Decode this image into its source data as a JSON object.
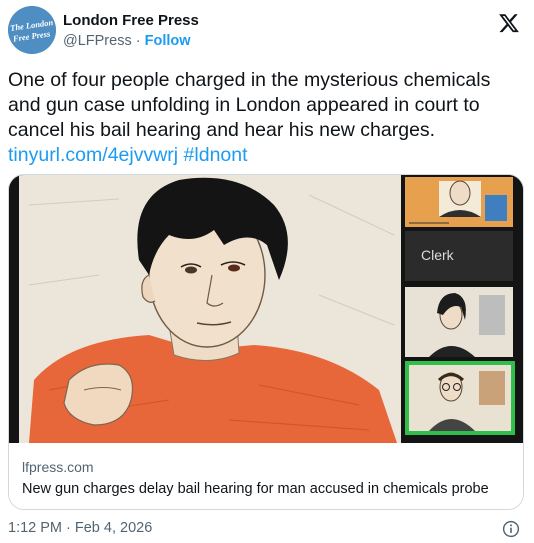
{
  "header": {
    "display_name": "London Free Press",
    "handle": "@LFPress",
    "separator": " · ",
    "follow_label": "Follow",
    "avatar_text_line1": "The London",
    "avatar_text_line2": "Free Press",
    "avatar_color": "#4f8ec2"
  },
  "tweet": {
    "text": "One of four people charged in the mysterious chemicals\nand gun case unfolding in London appeared in court to\ncancel his bail hearing and hear his new charges.",
    "link_url": "tinyurl.com/4ejvvwrj",
    "hashtag": "#ldnont"
  },
  "card": {
    "domain": "lfpress.com",
    "title": "New gun charges delay bail hearing for man accused in chemicals probe",
    "sketch_clerk_label": "Clerk",
    "accent_shirt_color": "#e8673a",
    "accent_frame_color": "#2fbf4a"
  },
  "meta": {
    "timestamp": "1:12 PM · Feb 4, 2026"
  },
  "icons": {
    "logo": "x-logo-icon",
    "info": "info-icon"
  }
}
